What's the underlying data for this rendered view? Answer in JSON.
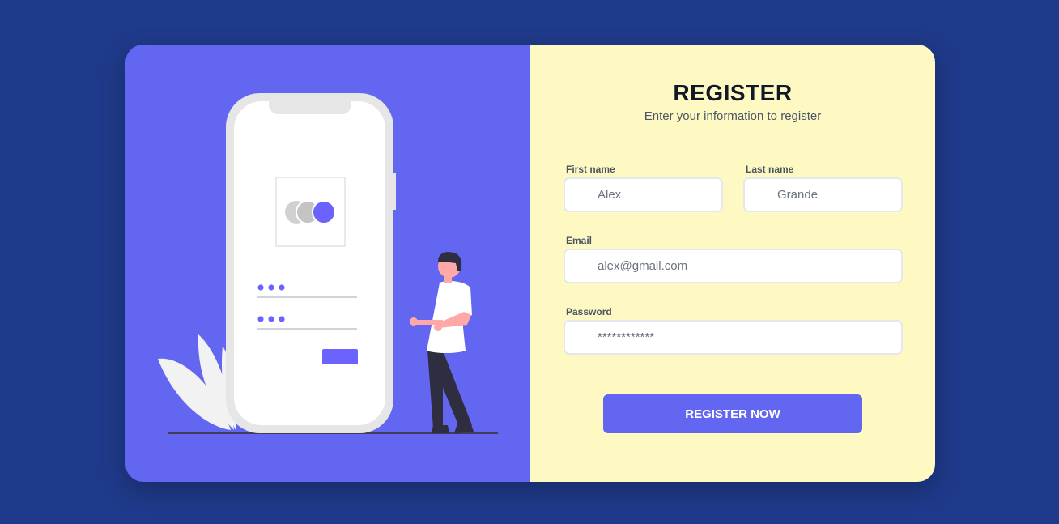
{
  "form": {
    "title": "REGISTER",
    "subtitle": "Enter your information to register",
    "first_name": {
      "label": "First name",
      "placeholder": "Alex"
    },
    "last_name": {
      "label": "Last name",
      "placeholder": "Grande"
    },
    "email": {
      "label": "Email",
      "placeholder": "alex@gmail.com"
    },
    "password": {
      "label": "Password",
      "placeholder": "************"
    },
    "submit_label": "REGISTER NOW"
  },
  "colors": {
    "page_background": "#1f3a8a",
    "illustration_panel": "#6366f1",
    "form_panel": "#fef9c3",
    "accent": "#6366f1"
  },
  "illustration": {
    "icons": [
      "phone-illustration",
      "person-illustration",
      "leaf-illustration"
    ]
  }
}
